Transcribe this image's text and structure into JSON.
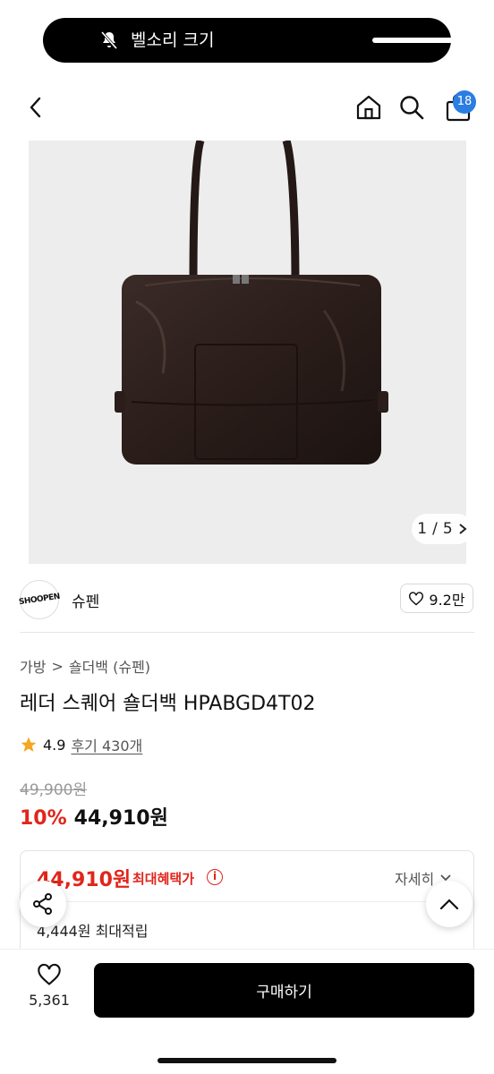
{
  "status": {
    "ringer_label": "벨소리 크기"
  },
  "header": {
    "cart_count": "18",
    "icons": [
      "back-icon",
      "home-icon",
      "search-icon",
      "cart-icon"
    ]
  },
  "gallery": {
    "page_current": "1",
    "page_sep": "/",
    "page_total": "5"
  },
  "brand": {
    "logo_text": "SHOOPEN",
    "name": "슈펜",
    "likes": "9.2만"
  },
  "breadcrumb": {
    "first": "가방",
    "sep": ">",
    "second": "숄더백 (슈펜)"
  },
  "product": {
    "title": "레더 스퀘어 숄더백 HPABGD4T02",
    "rating": "4.9",
    "reviews": "후기 430개",
    "original_price": "49,900원",
    "discount": "10%",
    "price": "44,910원"
  },
  "benefit": {
    "max_price": "44,910원",
    "max_label": "최대혜택가",
    "info": "i",
    "detail": "자세히",
    "points": "4,444원 최대적립"
  },
  "bottom": {
    "wish_count": "5,361",
    "buy_label": "구매하기"
  },
  "colors": {
    "accent_red": "#e1251b",
    "badge_blue": "#2a7de1",
    "bag": "#2b1f1c"
  }
}
